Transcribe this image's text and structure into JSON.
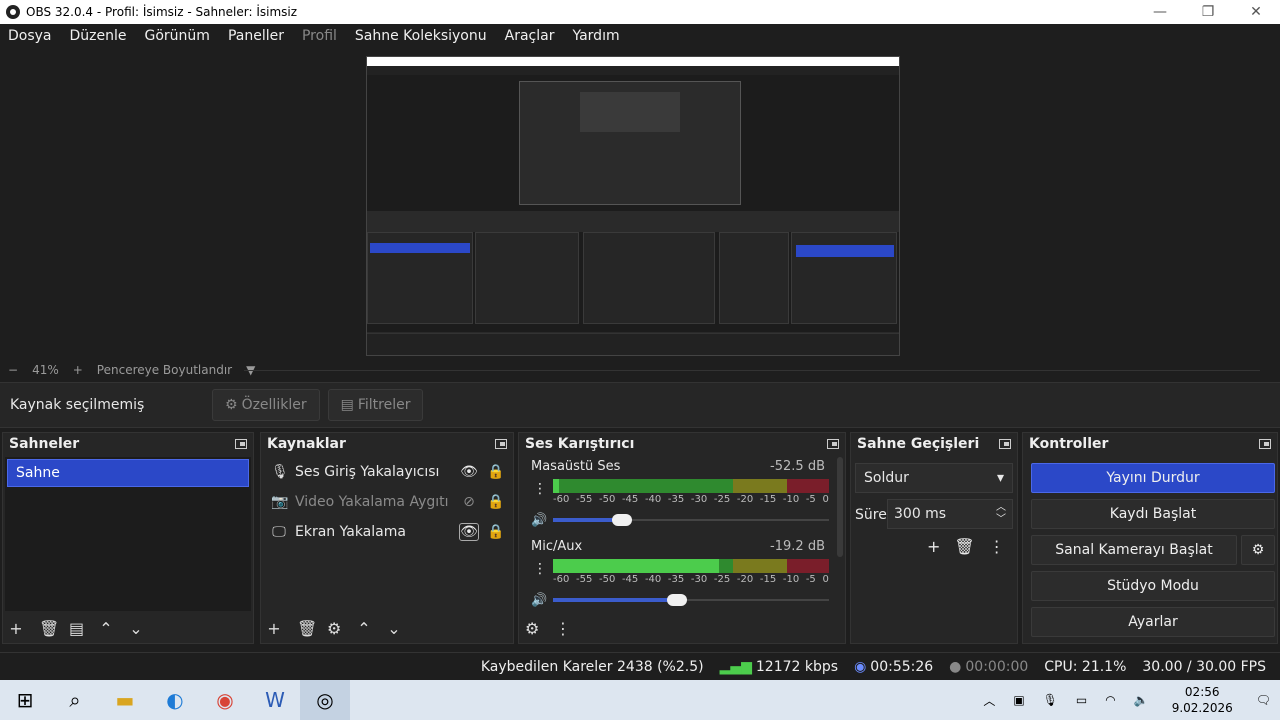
{
  "window": {
    "title": "OBS 32.0.4 - Profil: İsimsiz - Sahneler: İsimsiz"
  },
  "menu": [
    "Dosya",
    "Düzenle",
    "Görünüm",
    "Paneller",
    "Profil",
    "Sahne Koleksiyonu",
    "Araçlar",
    "Yardım"
  ],
  "zoom": {
    "minus": "−",
    "value": "41%",
    "plus": "+",
    "fit": "Pencereye Boyutlandır"
  },
  "source_toolbar": {
    "label": "Kaynak seçilmemiş",
    "properties": "Özellikler",
    "filters": "Filtreler"
  },
  "scenes": {
    "title": "Sahneler",
    "items": [
      "Sahne"
    ]
  },
  "sources": {
    "title": "Kaynaklar",
    "items": [
      {
        "name": "Ses Giriş Yakalayıcısı",
        "icon": "microphone-icon"
      },
      {
        "name": "Video Yakalama Aygıtı",
        "icon": "camera-icon"
      },
      {
        "name": "Ekran Yakalama",
        "icon": "monitor-icon"
      }
    ]
  },
  "mixer": {
    "title": "Ses Karıştırıcı",
    "channels": [
      {
        "name": "Masaüstü Ses",
        "db": "-52.5 dB",
        "level": 0.02,
        "volume": 0.25
      },
      {
        "name": "Mic/Aux",
        "db": "-19.2 dB",
        "level": 0.6,
        "volume": 0.45
      }
    ],
    "ticks": [
      "-60",
      "-55",
      "-50",
      "-45",
      "-40",
      "-35",
      "-30",
      "-25",
      "-20",
      "-15",
      "-10",
      "-5",
      "0"
    ]
  },
  "transitions": {
    "title": "Sahne Geçişleri",
    "type": "Soldur",
    "duration_label": "Süre",
    "duration": "300 ms"
  },
  "controls": {
    "title": "Kontroller",
    "stop_stream": "Yayını Durdur",
    "record": "Kaydı Başlat",
    "virtual_cam": "Sanal Kamerayı Başlat",
    "studio": "Stüdyo Modu",
    "settings": "Ayarlar"
  },
  "status": {
    "dropped": "Kaybedilen Kareler 2438 (%2.5)",
    "bitrate": "12172 kbps",
    "stream_time": "00:55:26",
    "rec_time": "00:00:00",
    "cpu": "CPU: 21.1%",
    "fps": "30.00 / 30.00 FPS"
  },
  "clock": {
    "time": "02:56",
    "date": "9.02.2026"
  },
  "colors": {
    "accent": "#2b48c8",
    "bg": "#1e1e1e",
    "panel": "#262626"
  }
}
